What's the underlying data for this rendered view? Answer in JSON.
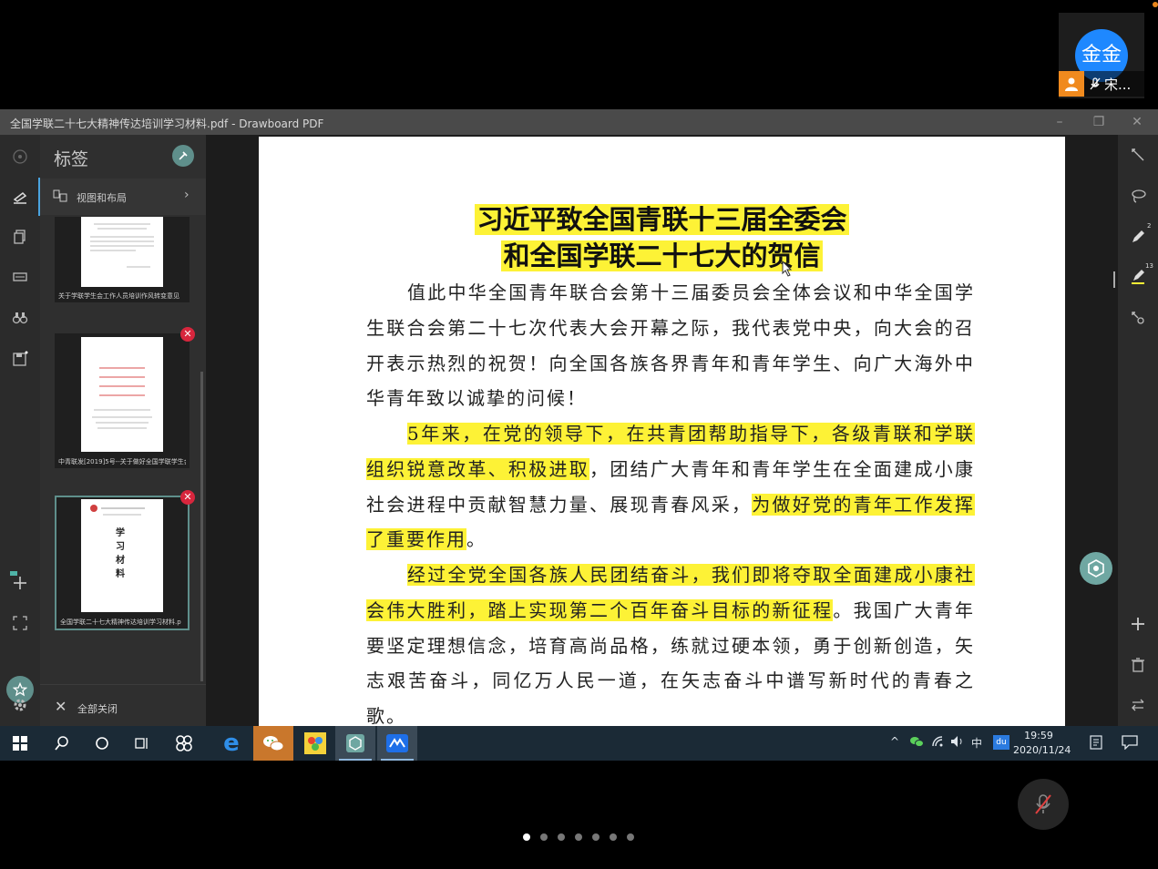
{
  "conference": {
    "participant_avatar_text": "金金",
    "participant_name": "宋...",
    "page_dots": [
      true,
      false,
      false,
      false,
      false,
      false,
      false
    ]
  },
  "window": {
    "title": "全国学联二十七大精神传达培训学习材料.pdf - Drawboard PDF"
  },
  "panel": {
    "title": "标签",
    "view_layout_label": "视图和布局",
    "close_all_label": "全部关闭",
    "thumbnails": [
      {
        "caption": "关于学联学生会工作人员培训作风转变意见"
      },
      {
        "caption": "中青联发[2019]5号--关于做好全国学联学生会改"
      },
      {
        "caption": "全国学联二十七大精神传达培训学习材料.p"
      }
    ],
    "thumb3_lines": [
      "学",
      "习",
      "材",
      "料"
    ]
  },
  "document": {
    "title_line1": "习近平致全国青联十三届全委会",
    "title_line2": "和全国学联二十七大的贺信",
    "p1": "值此中华全国青年联合会第十三届委员会全体会议和中华全国学生联合会第二十七次代表大会开幕之际，我代表党中央，向大会的召开表示热烈的祝贺！向全国各族各界青年和青年学生、向广大海外中华青年致以诚挚的问候！",
    "p2_hl1": "5年来，在党的领导下，在共青团帮助指导下，各级青联和学联组织锐意改革、积极进取",
    "p2_mid": "，团结广大青年和青年学生在全面建成小康社会进程中贡献智慧力量、展现青春风采，",
    "p2_hl2": "为做好党的青年工作发挥了重要作用",
    "p2_end": "。",
    "p3_hl": "经过全党全国各族人民团结奋斗，我们即将夺取全面建成小康社会伟大胜利，踏上实现第二个百年奋斗目标的新征程",
    "p3_rest": "。我国广大青年要坚定理想信念，培育高尚品格，练就过硬本领，勇于创新创造，矢志艰苦奋斗，同亿万人民一道，在矢志奋斗中谱写新时代的青春之歌。"
  },
  "right_rail": {
    "badge_pen": "2",
    "badge_highlighter": "13"
  },
  "taskbar": {
    "ime": "中",
    "baidu": "du",
    "time": "19:59",
    "date": "2020/11/24"
  },
  "colors": {
    "highlight": "#fdf236",
    "accent_teal": "#5f8f8b",
    "avatar_blue": "#1e88ff",
    "close_red": "#d7263d"
  }
}
